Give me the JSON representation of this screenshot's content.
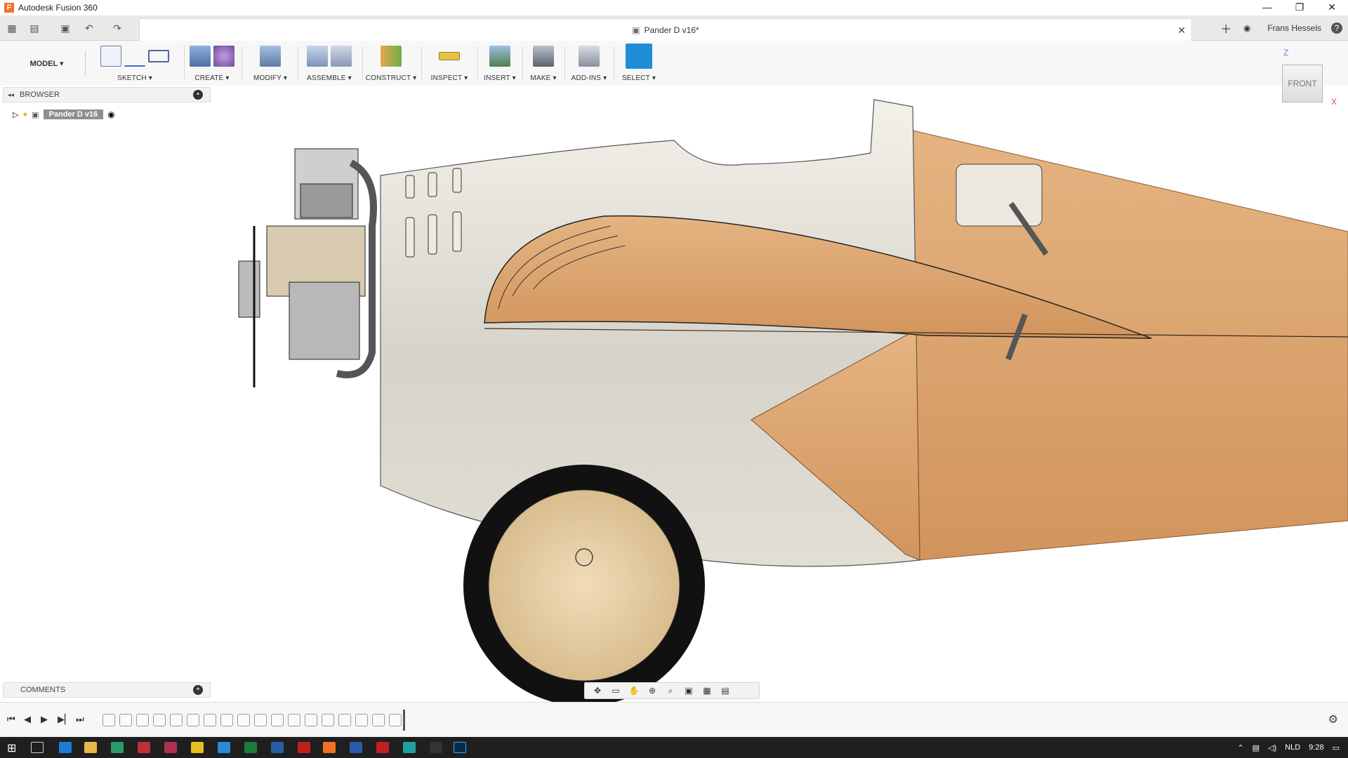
{
  "window": {
    "app_title": "Autodesk Fusion 360",
    "app_logo": "F",
    "minimize": "—",
    "restore": "❐",
    "close": "✕"
  },
  "tabbar": {
    "doc_title": "Pander D v16*",
    "user": "Frans Hessels",
    "help": "?"
  },
  "ribbon": {
    "workspace": "MODEL ▾",
    "groups": [
      {
        "label": "SKETCH ▾"
      },
      {
        "label": "CREATE ▾"
      },
      {
        "label": "MODIFY ▾"
      },
      {
        "label": "ASSEMBLE ▾"
      },
      {
        "label": "CONSTRUCT ▾"
      },
      {
        "label": "INSPECT ▾"
      },
      {
        "label": "INSERT ▾"
      },
      {
        "label": "MAKE ▾"
      },
      {
        "label": "ADD-INS ▾"
      },
      {
        "label": "SELECT ▾"
      }
    ]
  },
  "browser": {
    "title": "BROWSER",
    "root_item": "Pander D v16"
  },
  "comments": {
    "title": "COMMENTS"
  },
  "viewcube": {
    "face": "FRONT",
    "axis_z": "Z",
    "axis_x": "X"
  },
  "taskbar": {
    "lang": "NLD",
    "time": "9:28"
  }
}
